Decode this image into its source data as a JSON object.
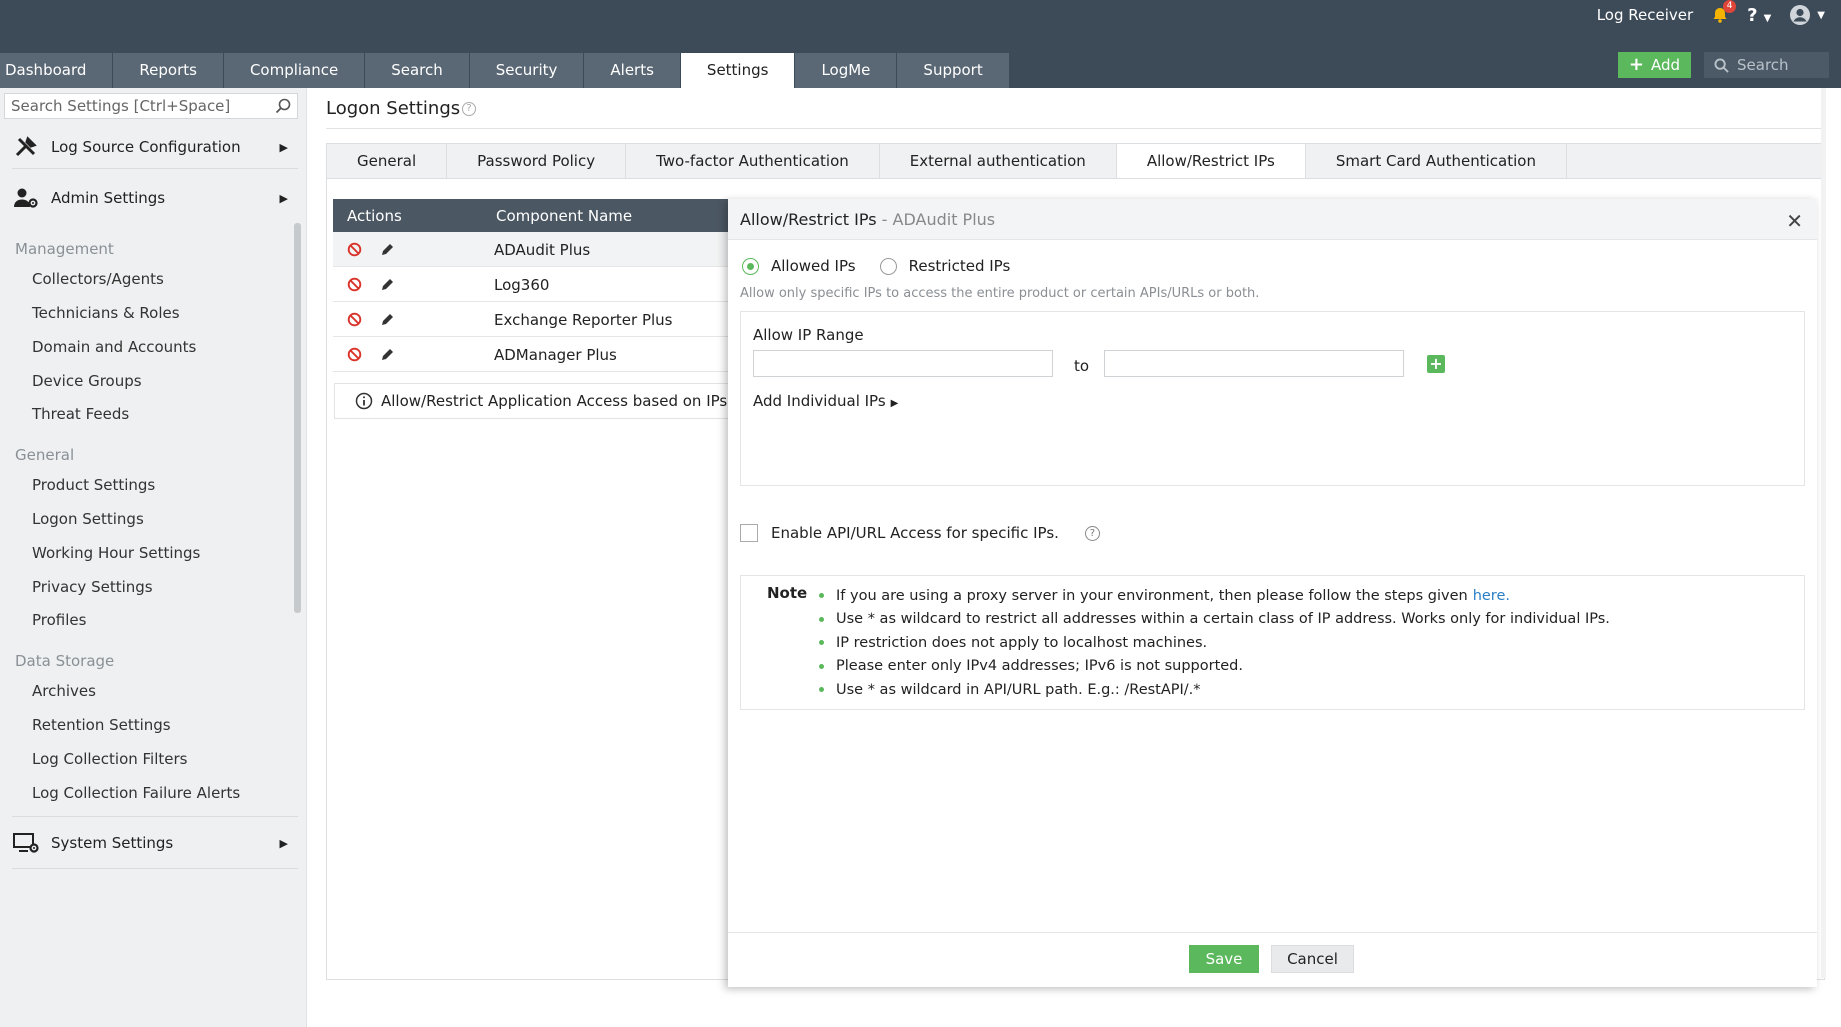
{
  "topbar": {
    "user_label": "Log Receiver",
    "notification_count": "4",
    "help_label": "?",
    "nav_tabs": [
      "Dashboard",
      "Reports",
      "Compliance",
      "Search",
      "Security",
      "Alerts",
      "Settings",
      "LogMe",
      "Support"
    ],
    "active_tab": "Settings",
    "add_label": "Add",
    "search_placeholder": "Search"
  },
  "sidebar": {
    "search_placeholder": "Search Settings [Ctrl+Space]",
    "log_source": "Log Source Configuration",
    "admin": "Admin Settings",
    "sections": [
      {
        "heading": "Management",
        "items": [
          "Collectors/Agents",
          "Technicians & Roles",
          "Domain and Accounts",
          "Device Groups",
          "Threat Feeds"
        ]
      },
      {
        "heading": "General",
        "items": [
          "Product Settings",
          "Logon Settings",
          "Working Hour Settings",
          "Privacy Settings",
          "Profiles"
        ]
      },
      {
        "heading": "Data Storage",
        "items": [
          "Archives",
          "Retention Settings",
          "Log Collection Filters",
          "Log Collection Failure Alerts"
        ]
      }
    ],
    "system": "System Settings"
  },
  "main": {
    "title": "Logon Settings",
    "title_help": "?",
    "subtabs": [
      "General",
      "Password Policy",
      "Two-factor Authentication",
      "External authentication",
      "Allow/Restrict IPs",
      "Smart Card Authentication"
    ],
    "active_subtab": "Allow/Restrict IPs",
    "table": {
      "headers": [
        "Actions",
        "Component Name"
      ],
      "rows": [
        "ADAudit Plus",
        "Log360",
        "Exchange Reporter Plus",
        "ADManager Plus"
      ]
    },
    "info_text": "Allow/Restrict Application Access based on IPs"
  },
  "dialog": {
    "title": "Allow/Restrict IPs",
    "title_sep": " - ",
    "subtitle": "ADAudit Plus",
    "close": "✕",
    "allowed_label": "Allowed IPs",
    "restricted_label": "Restricted IPs",
    "allowed_selected": true,
    "hint": "Allow only specific IPs to access the entire product or certain APIs/URLs or both.",
    "range_title": "Allow IP Range",
    "range_from_value": "",
    "range_to_label": "to",
    "range_to_value": "",
    "add_individual": "Add Individual IPs",
    "api_label": "Enable API/URL Access for specific IPs.",
    "api_checked": false,
    "api_help": "?",
    "note_label": "Note",
    "notes": [
      "If you are using a proxy server in your environment, then please follow the steps given",
      "Use * as wildcard to restrict all addresses within a certain class of IP address. Works only for individual IPs.",
      "IP restriction does not apply to localhost machines.",
      "Please enter only IPv4 addresses; IPv6 is not supported.",
      "Use * as wildcard in API/URL path. E.g.: /RestAPI/.*"
    ],
    "note_link": "here.",
    "save_label": "Save",
    "cancel_label": "Cancel"
  },
  "colors": {
    "topbar": "#3d4a57",
    "accent_green": "#5cb85c",
    "table_header": "#4b5763",
    "link_blue": "#2a7fc6",
    "block_red": "#d9342b"
  }
}
